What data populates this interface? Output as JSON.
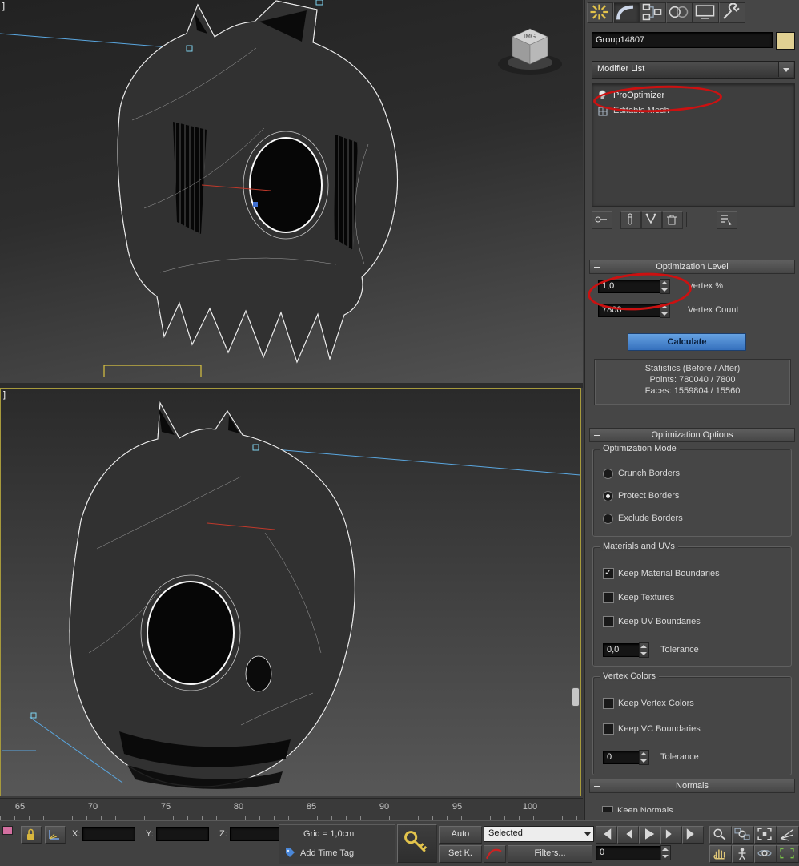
{
  "viewport_top": {
    "label": "]"
  },
  "viewport_bottom": {
    "label": "]"
  },
  "scene": {
    "cube_label": "IMG"
  },
  "command_panel": {
    "object_name": "Group14807",
    "modifier_list": {
      "label": "Modifier List"
    },
    "modifier_stack": [
      {
        "label": "ProOptimizer"
      },
      {
        "label": "Editable Mesh"
      }
    ],
    "optimization_level": {
      "title": "Optimization Level",
      "vertex_percent": {
        "value": "1,0",
        "label": "Vertex %"
      },
      "vertex_count": {
        "value": "7800",
        "label": "Vertex Count"
      },
      "calculate": "Calculate",
      "statistics": {
        "line1": "Statistics (Before / After)",
        "line2": "Points: 780040 / 7800",
        "line3": "Faces: 1559804 / 15560"
      }
    },
    "optimization_options": {
      "title": "Optimization Options",
      "optimization_mode": {
        "title": "Optimization Mode",
        "options": [
          {
            "label": "Crunch Borders"
          },
          {
            "label": "Protect Borders"
          },
          {
            "label": "Exclude Borders"
          }
        ]
      },
      "materials_uvs": {
        "title": "Materials and UVs",
        "options": [
          {
            "label": "Keep Material Boundaries"
          },
          {
            "label": "Keep Textures"
          },
          {
            "label": "Keep UV Boundaries"
          }
        ],
        "tolerance": {
          "value": "0,0",
          "label": "Tolerance"
        }
      },
      "vertex_colors": {
        "title": "Vertex Colors",
        "options": [
          {
            "label": "Keep Vertex Colors"
          },
          {
            "label": "Keep VC Boundaries"
          }
        ],
        "tolerance": {
          "value": "0",
          "label": "Tolerance"
        }
      }
    },
    "normals": {
      "title": "Normals",
      "clipped_option": "Keep Normals"
    }
  },
  "timeline": {
    "ticks": [
      "65",
      "70",
      "75",
      "80",
      "85",
      "90",
      "95",
      "100"
    ]
  },
  "status_bar": {
    "coords": {
      "x_label": "X:",
      "x_value": "",
      "y_label": "Y:",
      "y_value": "",
      "z_label": "Z:",
      "z_value": ""
    },
    "prompt": {
      "grid": "Grid = 1,0cm",
      "time_tag": "Add Time Tag"
    },
    "animation": {
      "auto": "Auto",
      "set_key": "Set K.",
      "selected_filter": "Selected",
      "filters": "Filters...",
      "time_value": "0"
    }
  },
  "colors": {
    "accent_blue": "#3f7fd2",
    "annotation_red": "#cc1111",
    "active_viewport_border": "#a79a3c",
    "wireframe": "#e8e8e8"
  }
}
